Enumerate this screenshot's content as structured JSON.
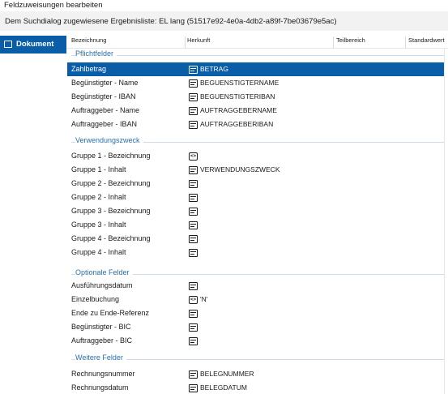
{
  "window": {
    "title": "Feldzuweisungen bearbeiten"
  },
  "subtitle": "Dem Suchdialog zugewiesene Ergebnisliste: EL lang (51517e92-4e0a-4db2-a89f-7be03679e5ac)",
  "nav": {
    "items": [
      {
        "label": "Dokument",
        "icon": "document-icon",
        "active": true
      }
    ]
  },
  "columns": {
    "bezeichnung": "Bezeichnung",
    "herkunft": "Herkunft",
    "teilbereich": "Teilbereich",
    "standardwert": "Standardwert"
  },
  "groups": {
    "pflicht": {
      "label": "Pflichtfelder",
      "rows": [
        {
          "label": "Zahlbetrag",
          "icon": "field-icon",
          "value": "BETRAG",
          "selected": true
        },
        {
          "label": "Begünstigter - Name",
          "icon": "field-icon",
          "value": "BEGUENSTIGTERNAME"
        },
        {
          "label": "Begünstigter - IBAN",
          "icon": "field-icon",
          "value": "BEGUENSTIGTERIBAN"
        },
        {
          "label": "Auftraggeber - Name",
          "icon": "field-icon",
          "value": "AUFTRAGGEBERNAME"
        },
        {
          "label": "Auftraggeber - IBAN",
          "icon": "field-icon",
          "value": "AUFTRAGGEBERIBAN"
        }
      ]
    },
    "verwendung": {
      "label": "Verwendungszweck",
      "rows": [
        {
          "label": "Gruppe 1 - Bezeichnung",
          "icon": "code-icon",
          "value": ""
        },
        {
          "label": "Gruppe 1 - Inhalt",
          "icon": "field-icon",
          "value": "VERWENDUNGSZWECK"
        },
        {
          "label": "Gruppe 2 - Bezeichnung",
          "icon": "field-icon",
          "value": ""
        },
        {
          "label": "Gruppe 2 - Inhalt",
          "icon": "field-icon",
          "value": ""
        },
        {
          "label": "Gruppe 3 - Bezeichnung",
          "icon": "field-icon",
          "value": ""
        },
        {
          "label": "Gruppe 3 - Inhalt",
          "icon": "field-icon",
          "value": ""
        },
        {
          "label": "Gruppe 4 - Bezeichnung",
          "icon": "field-icon",
          "value": ""
        },
        {
          "label": "Gruppe 4 - Inhalt",
          "icon": "field-icon",
          "value": ""
        }
      ]
    },
    "optional": {
      "label": "Optionale Felder",
      "rows": [
        {
          "label": "Ausführungsdatum",
          "icon": "field-icon",
          "value": ""
        },
        {
          "label": "Einzelbuchung",
          "icon": "code-icon",
          "value": "'N'"
        },
        {
          "label": "Ende zu Ende-Referenz",
          "icon": "field-icon",
          "value": ""
        },
        {
          "label": "Begünstigter - BIC",
          "icon": "field-icon",
          "value": ""
        },
        {
          "label": "Auftraggeber - BIC",
          "icon": "field-icon",
          "value": ""
        }
      ]
    },
    "weitere": {
      "label": "Weitere Felder",
      "rows": [
        {
          "label": "Rechnungsnummer",
          "icon": "field-icon",
          "value": "BELEGNUMMER"
        },
        {
          "label": "Rechnungsdatum",
          "icon": "field-icon",
          "value": "BELEGDATUM"
        }
      ]
    }
  },
  "colors": {
    "accent": "#0a5ea8",
    "group_label": "#2a6fb0",
    "subbar": "#f2f2f2"
  }
}
